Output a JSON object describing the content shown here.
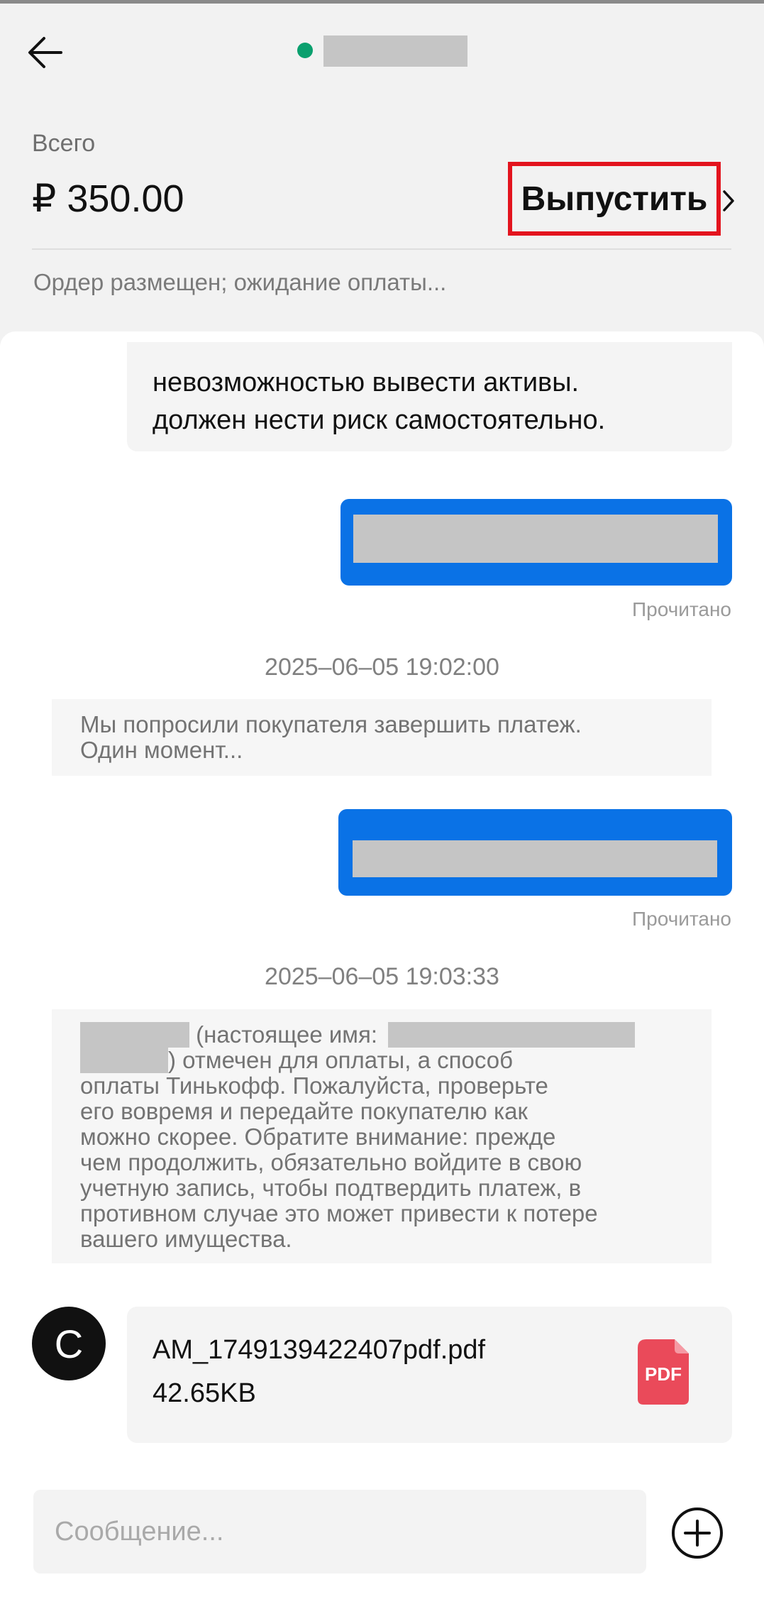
{
  "header": {
    "total_label": "Всего",
    "amount": "₽ 350.00",
    "release_button": "Выпустить",
    "status": "Ордер размещен; ожидание оплаты..."
  },
  "chat": {
    "seller_message_lines": [
      "невозможностью вывести активы.",
      "должен нести риск самостоятельно."
    ],
    "read_label_1": "Прочитано",
    "timestamp_1": "2025–06–05 19:02:00",
    "system_note_1_lines": [
      "Мы попросили покупателя завершить платеж.",
      "Один момент..."
    ],
    "read_label_2": "Прочитано",
    "timestamp_2": "2025–06–05 19:03:33",
    "system_note_2": {
      "row1_text": "(настоящее имя:",
      "row2_text": ") отмечен для оплаты, а способ",
      "lines": [
        "оплаты Тинькофф. Пожалуйста, проверьте",
        "его вовремя и передайте покупателю как",
        "можно скорее. Обратите внимание: прежде",
        "чем продолжить, обязательно войдите в свою",
        "учетную запись, чтобы подтвердить платеж, в",
        "противном случае это может привести к потере",
        "вашего имущества."
      ]
    },
    "avatar_letter": "C",
    "file": {
      "name": "AM_1749139422407pdf.pdf",
      "size": "42.65KB",
      "icon_label": "PDF"
    }
  },
  "composer": {
    "placeholder": "Сообщение..."
  },
  "colors": {
    "accent_blue": "#0a72e6",
    "highlight_red": "#e3141e",
    "online_green": "#0aa06e",
    "pdf_red": "#ea4a5a"
  }
}
